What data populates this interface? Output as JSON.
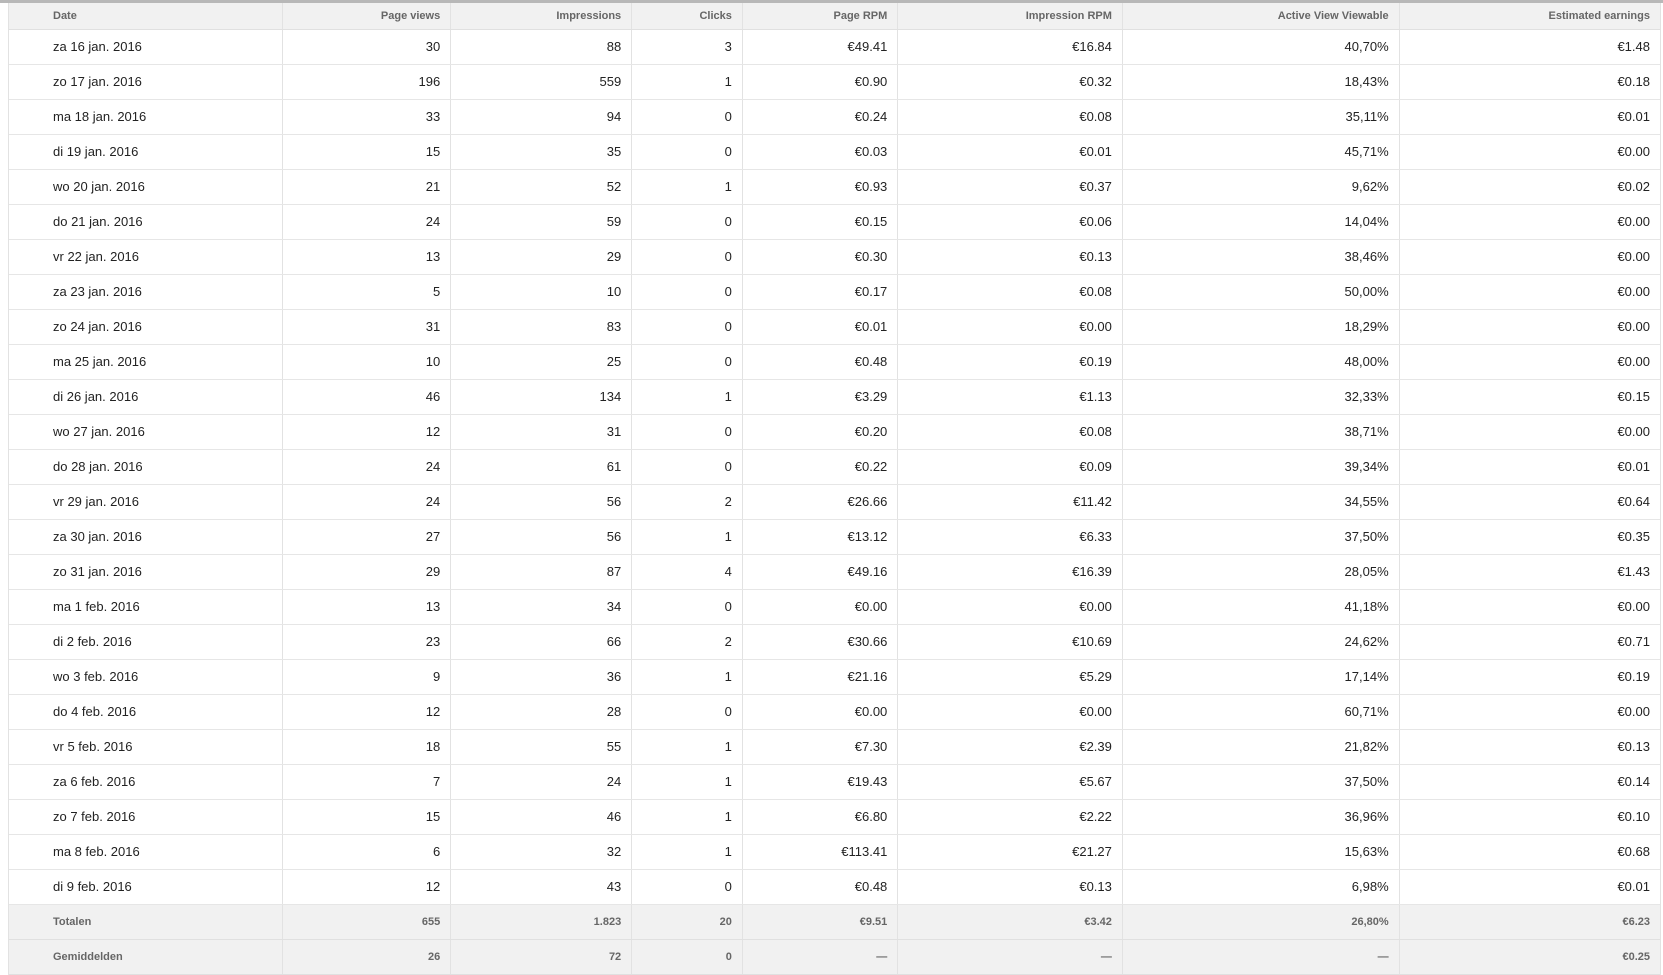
{
  "columns": [
    "Date",
    "Page views",
    "Impressions",
    "Clicks",
    "Page RPM",
    "Impression RPM",
    "Active View Viewable",
    "Estimated earnings"
  ],
  "rows": [
    [
      "za 16 jan. 2016",
      "30",
      "88",
      "3",
      "€49.41",
      "€16.84",
      "40,70%",
      "€1.48"
    ],
    [
      "zo 17 jan. 2016",
      "196",
      "559",
      "1",
      "€0.90",
      "€0.32",
      "18,43%",
      "€0.18"
    ],
    [
      "ma 18 jan. 2016",
      "33",
      "94",
      "0",
      "€0.24",
      "€0.08",
      "35,11%",
      "€0.01"
    ],
    [
      "di 19 jan. 2016",
      "15",
      "35",
      "0",
      "€0.03",
      "€0.01",
      "45,71%",
      "€0.00"
    ],
    [
      "wo 20 jan. 2016",
      "21",
      "52",
      "1",
      "€0.93",
      "€0.37",
      "9,62%",
      "€0.02"
    ],
    [
      "do 21 jan. 2016",
      "24",
      "59",
      "0",
      "€0.15",
      "€0.06",
      "14,04%",
      "€0.00"
    ],
    [
      "vr 22 jan. 2016",
      "13",
      "29",
      "0",
      "€0.30",
      "€0.13",
      "38,46%",
      "€0.00"
    ],
    [
      "za 23 jan. 2016",
      "5",
      "10",
      "0",
      "€0.17",
      "€0.08",
      "50,00%",
      "€0.00"
    ],
    [
      "zo 24 jan. 2016",
      "31",
      "83",
      "0",
      "€0.01",
      "€0.00",
      "18,29%",
      "€0.00"
    ],
    [
      "ma 25 jan. 2016",
      "10",
      "25",
      "0",
      "€0.48",
      "€0.19",
      "48,00%",
      "€0.00"
    ],
    [
      "di 26 jan. 2016",
      "46",
      "134",
      "1",
      "€3.29",
      "€1.13",
      "32,33%",
      "€0.15"
    ],
    [
      "wo 27 jan. 2016",
      "12",
      "31",
      "0",
      "€0.20",
      "€0.08",
      "38,71%",
      "€0.00"
    ],
    [
      "do 28 jan. 2016",
      "24",
      "61",
      "0",
      "€0.22",
      "€0.09",
      "39,34%",
      "€0.01"
    ],
    [
      "vr 29 jan. 2016",
      "24",
      "56",
      "2",
      "€26.66",
      "€11.42",
      "34,55%",
      "€0.64"
    ],
    [
      "za 30 jan. 2016",
      "27",
      "56",
      "1",
      "€13.12",
      "€6.33",
      "37,50%",
      "€0.35"
    ],
    [
      "zo 31 jan. 2016",
      "29",
      "87",
      "4",
      "€49.16",
      "€16.39",
      "28,05%",
      "€1.43"
    ],
    [
      "ma 1 feb. 2016",
      "13",
      "34",
      "0",
      "€0.00",
      "€0.00",
      "41,18%",
      "€0.00"
    ],
    [
      "di 2 feb. 2016",
      "23",
      "66",
      "2",
      "€30.66",
      "€10.69",
      "24,62%",
      "€0.71"
    ],
    [
      "wo 3 feb. 2016",
      "9",
      "36",
      "1",
      "€21.16",
      "€5.29",
      "17,14%",
      "€0.19"
    ],
    [
      "do 4 feb. 2016",
      "12",
      "28",
      "0",
      "€0.00",
      "€0.00",
      "60,71%",
      "€0.00"
    ],
    [
      "vr 5 feb. 2016",
      "18",
      "55",
      "1",
      "€7.30",
      "€2.39",
      "21,82%",
      "€0.13"
    ],
    [
      "za 6 feb. 2016",
      "7",
      "24",
      "1",
      "€19.43",
      "€5.67",
      "37,50%",
      "€0.14"
    ],
    [
      "zo 7 feb. 2016",
      "15",
      "46",
      "1",
      "€6.80",
      "€2.22",
      "36,96%",
      "€0.10"
    ],
    [
      "ma 8 feb. 2016",
      "6",
      "32",
      "1",
      "€113.41",
      "€21.27",
      "15,63%",
      "€0.68"
    ],
    [
      "di 9 feb. 2016",
      "12",
      "43",
      "0",
      "€0.48",
      "€0.13",
      "6,98%",
      "€0.01"
    ]
  ],
  "totals": [
    "Totalen",
    "655",
    "1.823",
    "20",
    "€9.51",
    "€3.42",
    "26,80%",
    "€6.23"
  ],
  "averages": [
    "Gemiddelden",
    "26",
    "72",
    "0",
    "—",
    "—",
    "—",
    "€0.25"
  ]
}
